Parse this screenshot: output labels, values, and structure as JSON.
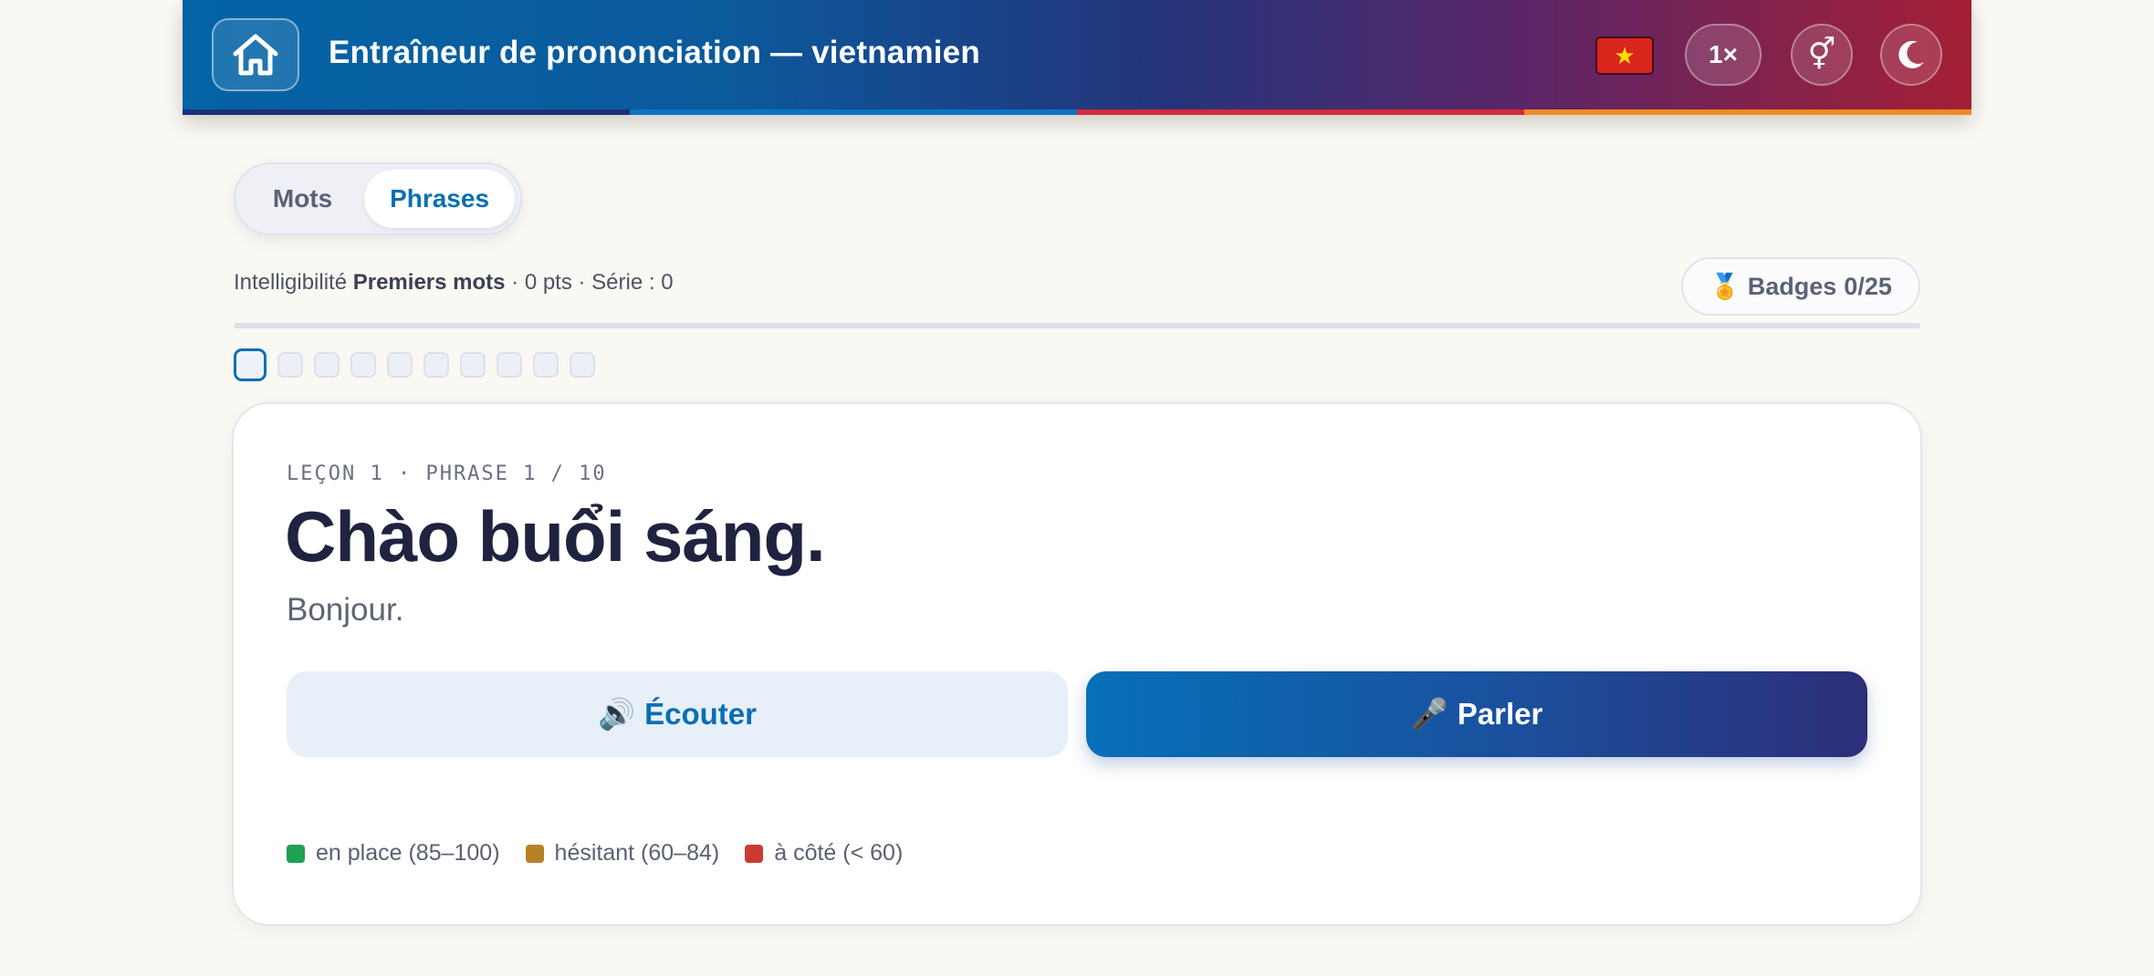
{
  "header": {
    "title": "Entraîneur de prononciation — vietnamien",
    "flag_icon": "vietnam-flag-icon",
    "flag_star": "★",
    "speed_label": "1×",
    "gender_symbol": "⚥",
    "stripe_colors": [
      "#1e2f7a",
      "#0a74c4",
      "#d32a3b",
      "#f08a22"
    ]
  },
  "mode": {
    "tabs": [
      {
        "label": "Mots",
        "active": false
      },
      {
        "label": "Phrases",
        "active": true
      }
    ]
  },
  "stats": {
    "prefix": "Intelligibilité ",
    "level": "Premiers mots",
    "suffix": " · 0 pts · Série : 0"
  },
  "badges": {
    "icon": "🏅",
    "label": "Badges",
    "count": "0/25"
  },
  "progress": {
    "fraction": 0,
    "total_dots": 10,
    "current_index": 0
  },
  "card": {
    "lesson_label": "LEÇON 1 · PHRASE 1 / 10",
    "phrase": "Chào buổi sáng.",
    "translation": "Bonjour.",
    "listen": {
      "icon": "🔊",
      "label": "Écouter"
    },
    "speak": {
      "icon": "🎤",
      "label": "Parler"
    }
  },
  "legend": [
    {
      "label": "en place (85–100)",
      "color": "#1fa055"
    },
    {
      "label": "hésitant (60–84)",
      "color": "#b98125"
    },
    {
      "label": "à côté (< 60)",
      "color": "#cc3b31"
    }
  ],
  "colors": {
    "accent": "#0a6eb4",
    "background": "#faf8f2"
  }
}
